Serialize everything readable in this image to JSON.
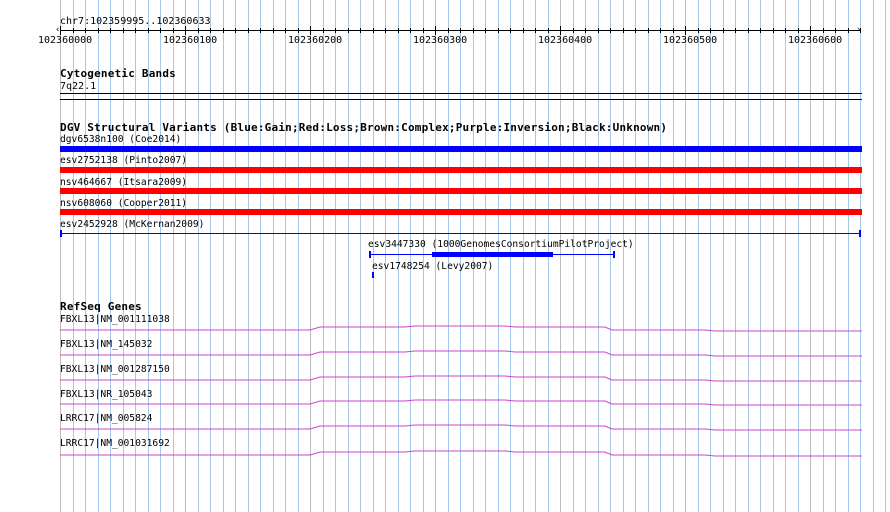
{
  "ruler": {
    "region_label": "chr7:102359995..102360633",
    "ticks": [
      "102360000",
      "102360100",
      "102360200",
      "102360300",
      "102360400",
      "102360500",
      "102360600"
    ]
  },
  "cyto": {
    "title": "Cytogenetic Bands",
    "band": "7q22.1"
  },
  "dgv": {
    "title": "DGV Structural Variants (Blue:Gain;Red:Loss;Brown:Complex;Purple:Inversion;Black:Unknown)",
    "features": [
      {
        "label": "dgv6538n100 (Coe2014)",
        "type": "Gain",
        "color": "#0000ff"
      },
      {
        "label": "esv2752138 (Pinto2007)",
        "type": "Loss",
        "color": "#ff0000"
      },
      {
        "label": "nsv464667 (Itsara2009)",
        "type": "Loss",
        "color": "#ff0000"
      },
      {
        "label": "nsv608060 (Cooper2011)",
        "type": "Loss",
        "color": "#ff0000"
      },
      {
        "label": "esv2452928 (McKernan2009)",
        "type": "Unknown",
        "color": "#0000ff"
      },
      {
        "label": "esv3447330 (1000GenomesConsortiumPilotProject)",
        "type": "Unknown",
        "color": "#0000ff"
      },
      {
        "label": "esv1748254 (Levy2007)",
        "type": "Unknown",
        "color": "#0000ff"
      }
    ]
  },
  "refseq": {
    "title": "RefSeq Genes",
    "genes": [
      {
        "label": "FBXL13|NM_001111038"
      },
      {
        "label": "FBXL13|NM_145032"
      },
      {
        "label": "FBXL13|NM_001287150"
      },
      {
        "label": "FBXL13|NR_105043"
      },
      {
        "label": "LRRC17|NM_005824"
      },
      {
        "label": "LRRC17|NM_001031692"
      }
    ],
    "intron_color": "#cc44cc"
  },
  "colors": {
    "grid": "#a8c8e8",
    "gain": "#0000ff",
    "loss": "#ff0000",
    "intron": "#cc44cc"
  }
}
